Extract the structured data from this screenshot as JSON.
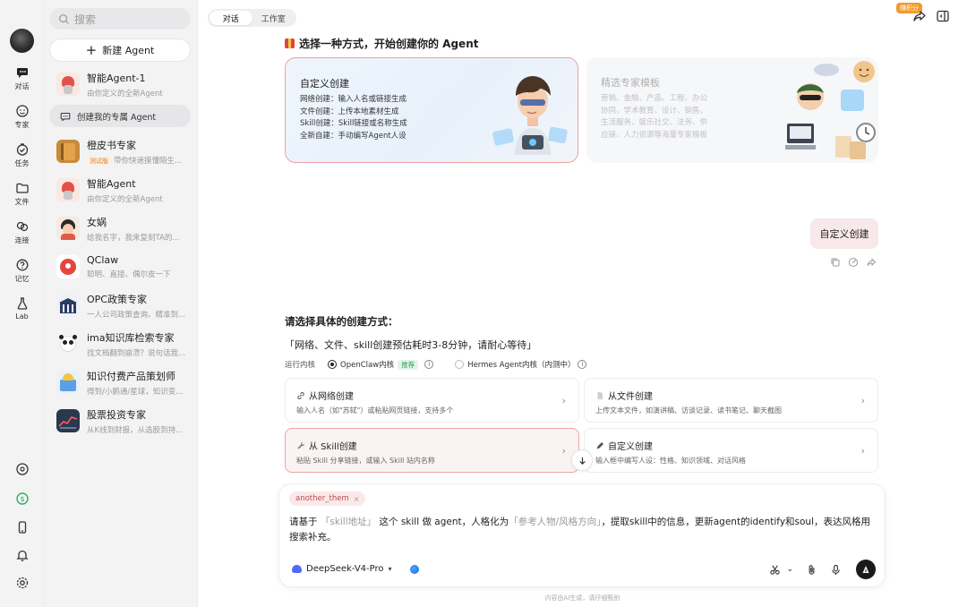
{
  "rail": {
    "items": [
      {
        "label": "对话",
        "icon": "chat-icon"
      },
      {
        "label": "专家",
        "icon": "expert-icon"
      },
      {
        "label": "任务",
        "icon": "task-icon"
      },
      {
        "label": "文件",
        "icon": "folder-icon"
      },
      {
        "label": "连接",
        "icon": "link-icon"
      },
      {
        "label": "记忆",
        "icon": "memory-icon"
      },
      {
        "label": "Lab",
        "icon": "flask-icon"
      }
    ]
  },
  "sidebar": {
    "search_placeholder": "搜索",
    "new_agent_label": "新建 Agent",
    "create_own_label": "创建我的专属 Agent",
    "agents": [
      {
        "name": "智能Agent-1",
        "desc": "由你定义的全新Agent"
      },
      {
        "name": "橙皮书专家",
        "badge": "测试版",
        "desc": "带你快速摸懂陌生..."
      },
      {
        "name": "智能Agent",
        "desc": "由你定义的全新Agent"
      },
      {
        "name": "女娲",
        "desc": "给我名字，我来复刻TA的..."
      },
      {
        "name": "QClaw",
        "desc": "聪明、直接、偶尔皮一下"
      },
      {
        "name": "OPC政策专家",
        "desc": "一人公司政策查询。精准到..."
      },
      {
        "name": "ima知识库检索专家",
        "desc": "找文档翻到崩溃？说句话我..."
      },
      {
        "name": "知识付费产品策划师",
        "desc": "得到/小鹅通/星球，知识变..."
      },
      {
        "name": "股票投资专家",
        "desc": "从K线到财报，从选股到持..."
      }
    ]
  },
  "tabs": [
    {
      "label": "对话"
    },
    {
      "label": "工作室"
    }
  ],
  "topbar": {
    "points_badge": "赚积分"
  },
  "main": {
    "heading": "选择一种方式，开始创建你的 Agent",
    "card_custom": {
      "title": "自定义创建",
      "lines": [
        "网络创建：输入人名或链接生成",
        "文件创建：上传本地素材生成",
        "Skill创建：Skill链接或名称生成",
        "全新自建：手动编写Agent人设"
      ]
    },
    "card_template": {
      "title": "精选专家模板",
      "desc": "营销、金融、产品、工程、办公协同、学术教育、设计、销售、生活服务、娱乐社交、法务、供应链、人力资源等海量专家模板"
    },
    "user_message": "自定义创建",
    "question_title": "请选择具体的创建方式：",
    "question_note": "「网络、文件、skill创建预估耗时3-8分钟，请耐心等待」",
    "kernel": {
      "label": "运行内核",
      "option1": "OpenClaw内核",
      "recommend_tag": "推荐",
      "option2": "Hermes Agent内核（内测中）"
    },
    "options": [
      {
        "title": "从网络创建",
        "desc": "输入人名（如\"苏轼\"）或粘贴网页链接，支持多个"
      },
      {
        "title": "从文件创建",
        "desc": "上传文本文件，如演讲稿、访谈记录、读书笔记、聊天截图"
      },
      {
        "title": "从 Skill创建",
        "desc": "粘贴 Skill 分享链接，或输入 Skill 站内名称"
      },
      {
        "title": "自定义创建",
        "desc": "输入框中编写人设：性格、知识领域、对话风格"
      }
    ]
  },
  "composer": {
    "chip": "another_them",
    "prompt_part1": "请基于 ",
    "prompt_ph1": "「skill地址」",
    "prompt_part2": " 这个 skill 做 agent，人格化为",
    "prompt_ph2": "「参考人物/风格方向」",
    "prompt_part3": "，提取skill中的信息，更新agent的identify和soul，表达风格用搜索补充。",
    "model": "DeepSeek-V4-Pro"
  },
  "footer_note": "内容由AI生成，请仔细甄别",
  "colors": {
    "accent": "#f0a3a3",
    "brand_orange": "#f39a2a"
  }
}
